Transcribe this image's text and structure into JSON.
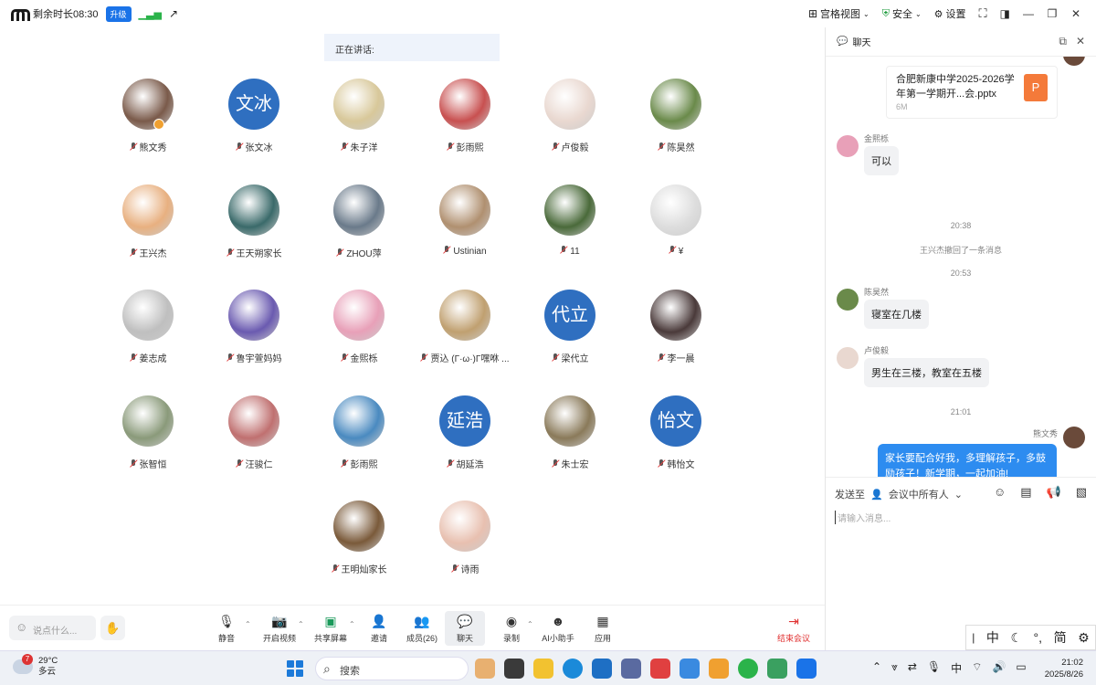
{
  "titlebar": {
    "remaining": "剩余时长08:30",
    "upgrade": "升级",
    "gallery_view": "宫格视图",
    "security": "安全",
    "settings": "设置"
  },
  "stage": {
    "speaking_label": "正在讲话:"
  },
  "participants": [
    {
      "name": "熊文秀",
      "avatar": "photo",
      "color": "#7a5a4a",
      "host": true
    },
    {
      "name": "张文冰",
      "avatar": "text",
      "text": "文冰"
    },
    {
      "name": "朱子洋",
      "avatar": "photo",
      "color": "#d8c89a"
    },
    {
      "name": "彭雨熙",
      "avatar": "photo",
      "color": "#c85050"
    },
    {
      "name": "卢俊毅",
      "avatar": "photo",
      "color": "#e9d8d0"
    },
    {
      "name": "陈昊然",
      "avatar": "photo",
      "color": "#6a8a4a"
    },
    {
      "name": "王兴杰",
      "avatar": "photo",
      "color": "#e8b080"
    },
    {
      "name": "王天朔家长",
      "avatar": "photo",
      "color": "#3a6a6a"
    },
    {
      "name": "ZHOU萍",
      "avatar": "photo",
      "color": "#6a7a8a"
    },
    {
      "name": "Ustinian",
      "avatar": "photo",
      "color": "#b09070"
    },
    {
      "name": "11",
      "avatar": "photo",
      "color": "#4a6a3a"
    },
    {
      "name": "¥",
      "avatar": "photo",
      "color": "#dddddd"
    },
    {
      "name": "姜志成",
      "avatar": "photo",
      "color": "#bfbfbf"
    },
    {
      "name": "鲁宇萱妈妈",
      "avatar": "photo",
      "color": "#6a5ab0"
    },
    {
      "name": "金熙栎",
      "avatar": "photo",
      "color": "#e8a0b8"
    },
    {
      "name": "贾込 (Γ·ω·)Γ嘿咻 ...",
      "avatar": "photo",
      "color": "#c0a070"
    },
    {
      "name": "梁代立",
      "avatar": "text",
      "text": "代立"
    },
    {
      "name": "李一晨",
      "avatar": "photo",
      "color": "#4a3a3a"
    },
    {
      "name": "张智恒",
      "avatar": "photo",
      "color": "#8a9a7a"
    },
    {
      "name": "汪骏仁",
      "avatar": "photo",
      "color": "#c07070"
    },
    {
      "name": "彭雨熙",
      "avatar": "photo",
      "color": "#4a8ac0"
    },
    {
      "name": "胡延浩",
      "avatar": "text",
      "text": "延浩"
    },
    {
      "name": "朱士宏",
      "avatar": "photo",
      "color": "#8a7a5a"
    },
    {
      "name": "韩怡文",
      "avatar": "text",
      "text": "怡文"
    },
    {
      "name": "王明灿家长",
      "avatar": "photo",
      "color": "#7a5a3a"
    },
    {
      "name": "诗雨",
      "avatar": "photo",
      "color": "#e8c0b0"
    }
  ],
  "toolbar": {
    "say_placeholder": "说点什么...",
    "mute": "静音",
    "video": "开启视频",
    "share": "共享屏幕",
    "invite": "邀请",
    "members": "成员(26)",
    "chat": "聊天",
    "record": "录制",
    "ai": "AI小助手",
    "apps": "应用",
    "end": "结束会议"
  },
  "chat": {
    "title": "聊天",
    "file_name": "合肥新康中学2025-2026学年第一学期开...会.pptx",
    "file_size": "6M",
    "file_icon": "P",
    "messages": [
      {
        "who": "金熙栎",
        "text": "可以"
      },
      {
        "who": "陈昊然",
        "text": "寝室在几楼"
      },
      {
        "who": "卢俊毅",
        "text": "男生在三楼，教室在五楼"
      }
    ],
    "time1": "20:38",
    "recall": "王兴杰撤回了一条消息",
    "time2": "20:53",
    "time3": "21:01",
    "mine_who": "熊文秀",
    "mine_text": "家长要配合好我，多理解孩子，多鼓励孩子！新学期，一起加油!",
    "send_to": "发送至",
    "send_target": "会议中所有人",
    "input_placeholder": "请输入消息..."
  },
  "ime": {
    "lang": "中",
    "punct": "°,",
    "mode": "简"
  },
  "taskbar": {
    "temp": "29°C",
    "weather": "多云",
    "badge": "7",
    "search": "搜索",
    "lang": "中",
    "time": "21:02",
    "date": "2025/8/26"
  }
}
